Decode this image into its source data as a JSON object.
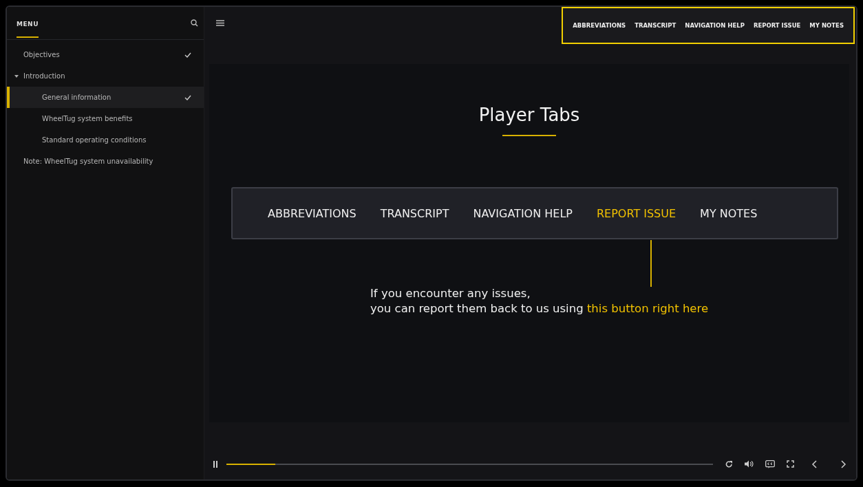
{
  "sidebar": {
    "title": "MENU",
    "items": [
      {
        "label": "Objectives",
        "completed": true,
        "selected": false
      },
      {
        "label": "Introduction",
        "completed": false,
        "selected": false,
        "expanded": true,
        "children": [
          {
            "label": "General information",
            "completed": true,
            "selected": true
          },
          {
            "label": "WheelTug system benefits",
            "completed": false,
            "selected": false
          },
          {
            "label": "Standard operating conditions",
            "completed": false,
            "selected": false
          }
        ]
      },
      {
        "label": "Note: WheelTug system unavailability",
        "completed": false,
        "selected": false
      }
    ]
  },
  "header": {
    "tabs": [
      "ABBREVIATIONS",
      "TRANSCRIPT",
      "NAVIGATION HELP",
      "REPORT ISSUE",
      "MY NOTES"
    ],
    "highlighted": true
  },
  "slide": {
    "title": "Player Tabs",
    "tabs": [
      {
        "label": "ABBREVIATIONS",
        "selected": false
      },
      {
        "label": "TRANSCRIPT",
        "selected": false
      },
      {
        "label": "NAVIGATION HELP",
        "selected": false
      },
      {
        "label": "REPORT ISSUE",
        "selected": true
      },
      {
        "label": "MY NOTES",
        "selected": false
      }
    ],
    "caption": {
      "line_1": "If you encounter any issues,",
      "line_2": "you can report them back to us using",
      "highlight": "this button right here"
    }
  },
  "player": {
    "playing": true,
    "progress": {
      "level": 0.1
    }
  }
}
